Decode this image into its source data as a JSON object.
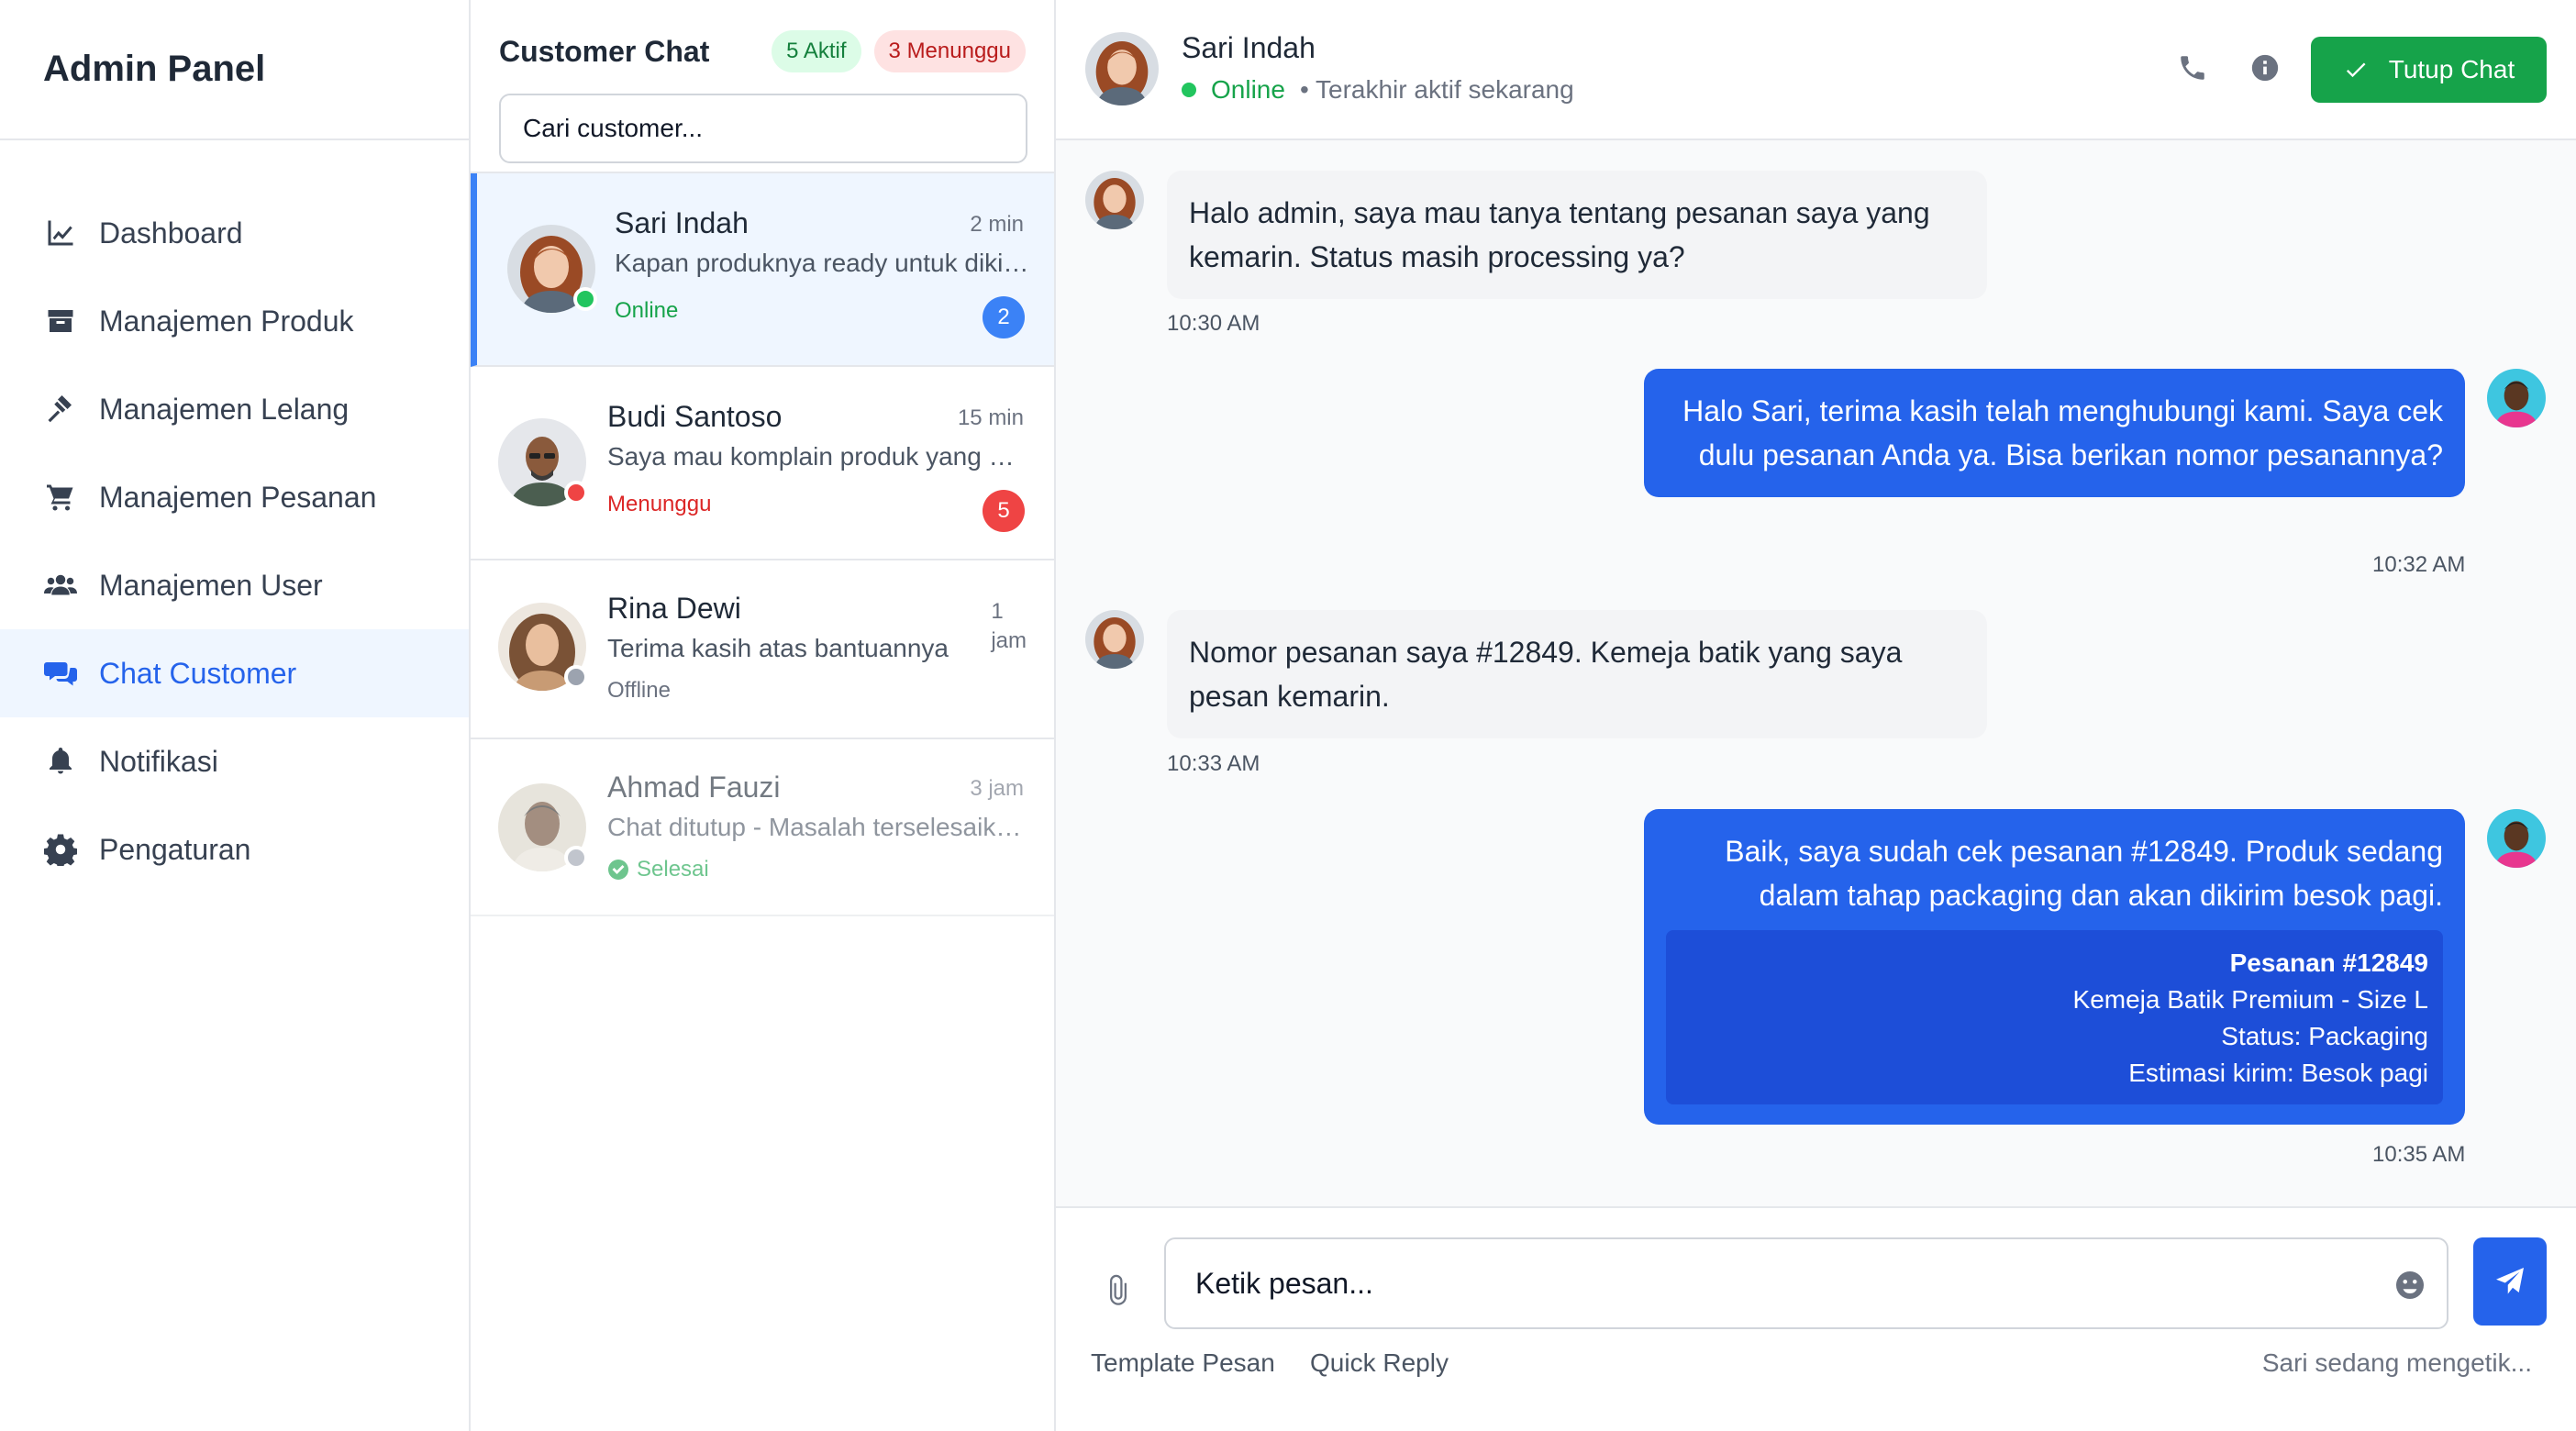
{
  "sidebar": {
    "title": "Admin Panel",
    "items": [
      {
        "label": "Dashboard",
        "icon": "chart-line-icon"
      },
      {
        "label": "Manajemen Produk",
        "icon": "box-icon"
      },
      {
        "label": "Manajemen Lelang",
        "icon": "gavel-icon"
      },
      {
        "label": "Manajemen Pesanan",
        "icon": "cart-icon"
      },
      {
        "label": "Manajemen User",
        "icon": "users-icon"
      },
      {
        "label": "Chat Customer",
        "icon": "comments-icon",
        "active": true
      },
      {
        "label": "Notifikasi",
        "icon": "bell-icon"
      },
      {
        "label": "Pengaturan",
        "icon": "gear-icon"
      }
    ]
  },
  "list": {
    "title": "Customer Chat",
    "active_count": "5 Aktif",
    "waiting_count": "3 Menunggu",
    "search_placeholder": "Cari customer...",
    "conversations": [
      {
        "name": "Sari Indah",
        "time": "2 min",
        "preview": "Kapan produknya ready untuk dikirim?",
        "status": "Online",
        "unread": "2"
      },
      {
        "name": "Budi Santoso",
        "time": "15 min",
        "preview": "Saya mau komplain produk yang rusak",
        "status": "Menunggu",
        "unread": "5"
      },
      {
        "name": "Rina Dewi",
        "time_1": "1",
        "time_2": "jam",
        "preview": "Terima kasih atas bantuannya",
        "status": "Offline"
      },
      {
        "name": "Ahmad Fauzi",
        "time": "3 jam",
        "preview": "Chat ditutup - Masalah terselesaikan",
        "status": "Selesai"
      }
    ]
  },
  "chat": {
    "name": "Sari Indah",
    "status": "Online",
    "last_seen": "• Terakhir aktif sekarang",
    "close_label": "Tutup Chat",
    "messages": [
      {
        "from": "customer",
        "line1": "Halo admin, saya mau tanya tentang pesanan saya yang",
        "line2": "kemarin. Status masih processing ya?",
        "time": "10:30 AM"
      },
      {
        "from": "admin",
        "line1": "Halo Sari, terima kasih telah menghubungi kami. Saya cek",
        "line2": "dulu pesanan Anda ya. Bisa berikan nomor pesanannya?",
        "time": "10:32 AM"
      },
      {
        "from": "customer",
        "line1": "Nomor pesanan saya #12849. Kemeja batik yang saya",
        "line2": "pesan kemarin.",
        "time": "10:33 AM"
      },
      {
        "from": "admin",
        "line1": "Baik, saya sudah cek pesanan #12849. Produk sedang",
        "line2": "dalam tahap packaging dan akan dikirim besok pagi.",
        "time": "10:35 AM",
        "order": {
          "title": "Pesanan #12849",
          "product": "Kemeja Batik Premium - Size L",
          "status": "Status: Packaging",
          "eta": "Estimasi kirim: Besok pagi"
        }
      }
    ],
    "input_placeholder": "Ketik pesan...",
    "template_label": "Template Pesan",
    "quick_reply_label": "Quick Reply",
    "typing_text": "Sari sedang mengetik..."
  },
  "colors": {
    "accent": "#2563eb",
    "success": "#16a34a",
    "danger": "#ef4444",
    "active_bg": "#eff6ff"
  }
}
